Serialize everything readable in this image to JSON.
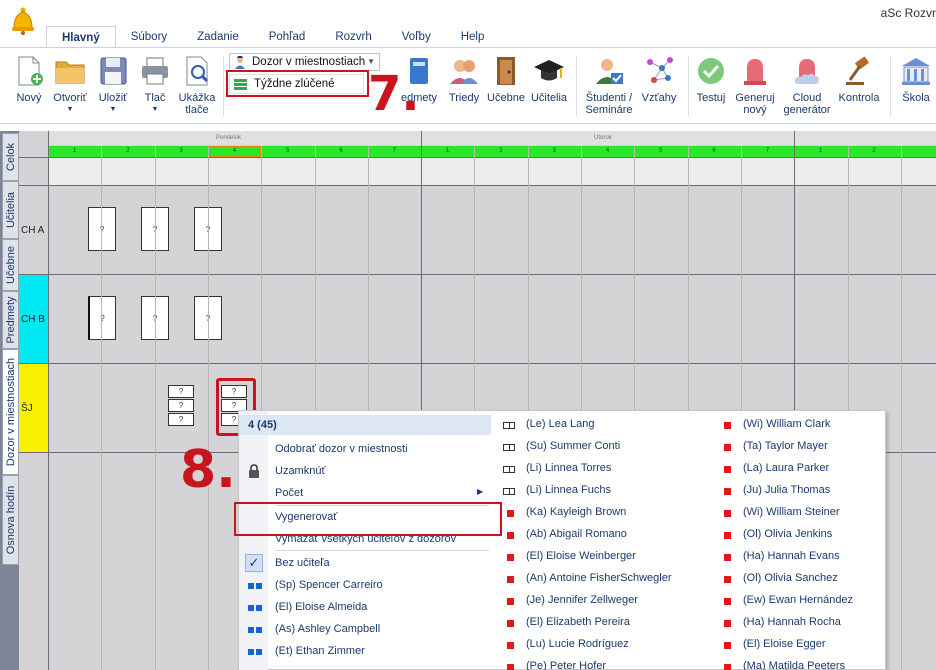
{
  "app": {
    "title": "aSc Rozvr"
  },
  "menu": {
    "tabs": [
      {
        "label": "Hlavný",
        "active": true
      },
      {
        "label": "Súbory"
      },
      {
        "label": "Zadanie"
      },
      {
        "label": "Pohľad"
      },
      {
        "label": "Rozvrh"
      },
      {
        "label": "Voľby"
      },
      {
        "label": "Help"
      }
    ]
  },
  "ribbon": {
    "new": "Nový",
    "open": "Otvoriť",
    "save": "Uložiť",
    "print": "Tlač",
    "preview_1": "Ukážka",
    "preview_2": "tlače",
    "view_select": "Dozor v miestnostiach",
    "view_option": "Týždne zlúčené",
    "subjects": "edmety",
    "classes": "Triedy",
    "rooms": "Učebne",
    "teachers": "Učitelia",
    "students_1": "Študenti /",
    "students_2": "Semináre",
    "relations": "Vzťahy",
    "test": "Testuj",
    "generate_1": "Generuj",
    "generate_2": "nový",
    "cloud_1": "Cloud",
    "cloud_2": "generátor",
    "check": "Kontrola",
    "school": "Škola"
  },
  "annotations": {
    "step7": "7.",
    "step8": "8."
  },
  "side_tabs": [
    {
      "label": "Celok"
    },
    {
      "label": "Učitelia"
    },
    {
      "label": "Učebne"
    },
    {
      "label": "Predmety"
    },
    {
      "label": "Dozor v miestnostiach",
      "active": true
    },
    {
      "label": "Osnova hodín"
    }
  ],
  "grid": {
    "days": [
      "Pondelok",
      "Utorok"
    ],
    "periods": [
      "1",
      "2",
      "3",
      "4",
      "5",
      "6",
      "7",
      "1",
      "2",
      "3",
      "4",
      "5",
      "6",
      "7",
      "1",
      "2"
    ],
    "rows": [
      {
        "label": "CH A",
        "color": "#d4d4d6"
      },
      {
        "label": "CH B",
        "color": "#00e8f4"
      },
      {
        "label": "ŠJ",
        "color": "#f8f000"
      }
    ],
    "card_text": "?"
  },
  "context_menu": {
    "header": "4 (45)",
    "items": {
      "remove": "Odobrať dozor v miestnosti",
      "lock": "Uzamknúť",
      "count": "Počet",
      "generate": "Vygenerovať",
      "clear_all": "Vymazať všetkých učiteľov z dozorov",
      "no_teacher": "Bez učiteľa"
    },
    "teachers_left": [
      "(Sp) Spencer Carreiro",
      "(El) Eloise Almeida",
      "(As) Ashley Campbell",
      "(Et) Ethan Zimmer"
    ],
    "teachers_mid": [
      {
        "name": "(Le) Lea Lang",
        "mark": "outline"
      },
      {
        "name": "(Su) Summer Conti",
        "mark": "outline"
      },
      {
        "name": "(Li) Linnea Torres",
        "mark": "outline"
      },
      {
        "name": "(Li) Linnea Fuchs",
        "mark": "outline"
      },
      {
        "name": "(Ka) Kayleigh Brown",
        "mark": "red"
      },
      {
        "name": "(Ab) Abigail Romano",
        "mark": "red"
      },
      {
        "name": "(El) Eloise Weinberger",
        "mark": "red"
      },
      {
        "name": "(An) Antoine FisherSchwegler",
        "mark": "red"
      },
      {
        "name": "(Je) Jennifer Zellweger",
        "mark": "red"
      },
      {
        "name": "(El) Elizabeth Pereira",
        "mark": "red"
      },
      {
        "name": "(Lu) Lucie Rodríguez",
        "mark": "red"
      },
      {
        "name": "(Pe) Peter Hofer",
        "mark": "red"
      }
    ],
    "teachers_right": [
      {
        "name": "(Wi) William Clark",
        "mark": "red"
      },
      {
        "name": "(Ta) Taylor Mayer",
        "mark": "red"
      },
      {
        "name": "(La) Laura Parker",
        "mark": "red"
      },
      {
        "name": "(Ju) Julia Thomas",
        "mark": "red"
      },
      {
        "name": "(Wi) William Steiner",
        "mark": "red"
      },
      {
        "name": "(Ol) Olivia Jenkins",
        "mark": "red"
      },
      {
        "name": "(Ha) Hannah Evans",
        "mark": "red"
      },
      {
        "name": "(Ol) Olivia Sanchez",
        "mark": "red"
      },
      {
        "name": "(Ew) Ewan Hernández",
        "mark": "red"
      },
      {
        "name": "(Ha) Hannah Rocha",
        "mark": "red"
      },
      {
        "name": "(El) Eloise Egger",
        "mark": "red"
      },
      {
        "name": "(Ma) Matilda Peeters",
        "mark": "red"
      }
    ]
  },
  "colors": {
    "accent_red": "#c8151d",
    "period_green": "#29e829",
    "text_blue": "#1b3a6b"
  }
}
